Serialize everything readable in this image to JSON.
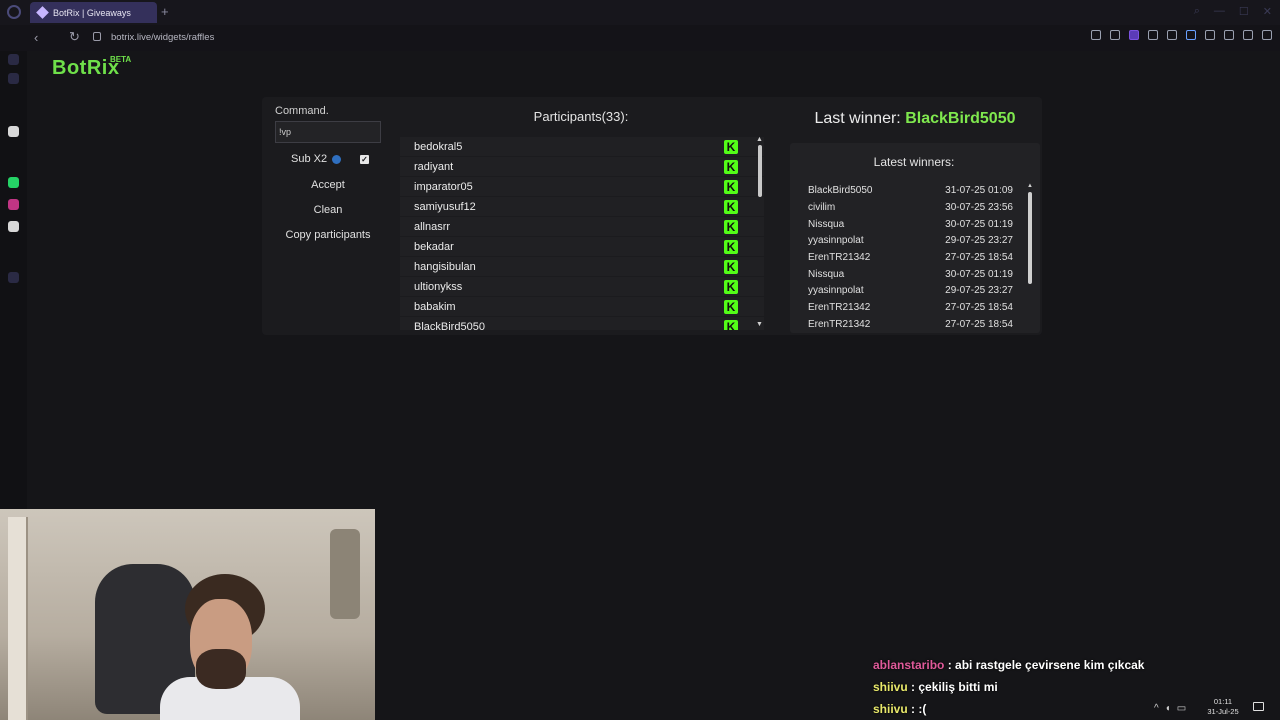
{
  "browser": {
    "tab_title": "BotRix | Giveaways",
    "new_tab_symbol": "+",
    "url": "botrix.live/widgets/raffles"
  },
  "app": {
    "brand": "BotRix",
    "brand_badge": "BETA",
    "accent_color": "#6fe04a"
  },
  "command": {
    "label": "Command.",
    "value": "!vp",
    "sub_label": "Sub X2",
    "sub_checked": true,
    "accept_label": "Accept",
    "clean_label": "Clean",
    "copy_label": "Copy participants"
  },
  "participants": {
    "title": "Participants(33):",
    "platform_icon": "kick-icon",
    "items": [
      "bedokral5",
      "radiyant",
      "imparator05",
      "samiyusuf12",
      "allnasrr",
      "bekadar",
      "hangisibulan",
      "ultionykss",
      "babakim",
      "BlackBird5050"
    ]
  },
  "last_winner": {
    "prefix": "Last winner:",
    "name": "BlackBird5050"
  },
  "latest_winners": {
    "title": "Latest winners:",
    "items": [
      {
        "name": "BlackBird5050",
        "date": "31-07-25 01:09"
      },
      {
        "name": "civilim",
        "date": "30-07-25 23:56"
      },
      {
        "name": "Nissqua",
        "date": "30-07-25 01:19"
      },
      {
        "name": "yyasinnpolat",
        "date": "29-07-25 23:27"
      },
      {
        "name": "ErenTR21342",
        "date": "27-07-25 18:54"
      },
      {
        "name": "Nissqua",
        "date": "30-07-25 01:19"
      },
      {
        "name": "yyasinnpolat",
        "date": "29-07-25 23:27"
      },
      {
        "name": "ErenTR21342",
        "date": "27-07-25 18:54"
      },
      {
        "name": "ErenTR21342",
        "date": "27-07-25 18:54"
      }
    ]
  },
  "chat": [
    {
      "user": "ablanstaribo",
      "message": " : abi rastgele çevirsene kim çıkcak"
    },
    {
      "user": "shiivu",
      "message": " : çekiliş bitti mi"
    },
    {
      "user": "shiivu",
      "message": " : :("
    }
  ],
  "taskbar": {
    "time": "01:11",
    "date": "31-Jul-25"
  }
}
